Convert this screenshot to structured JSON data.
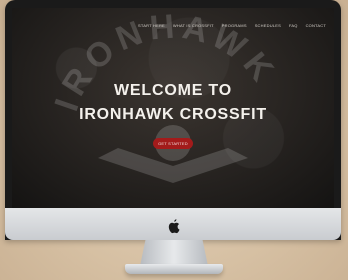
{
  "site": {
    "nav_items": [
      "START HERE",
      "WHAT IS CROSSFIT",
      "PROGRAMS",
      "SCHEDULES",
      "FAQ",
      "CONTACT"
    ],
    "hero_line1": "WELCOME TO",
    "hero_line2": "IRONHAWK CROSSFIT",
    "cta_label": "GET STARTED",
    "emblem_text": "IRONHAWK"
  },
  "device": {
    "logo_icon": "apple-logo-icon"
  },
  "colors": {
    "cta": "#a31b1b",
    "screen_bg": "#2a2623",
    "wall": "#d9c4a9"
  }
}
